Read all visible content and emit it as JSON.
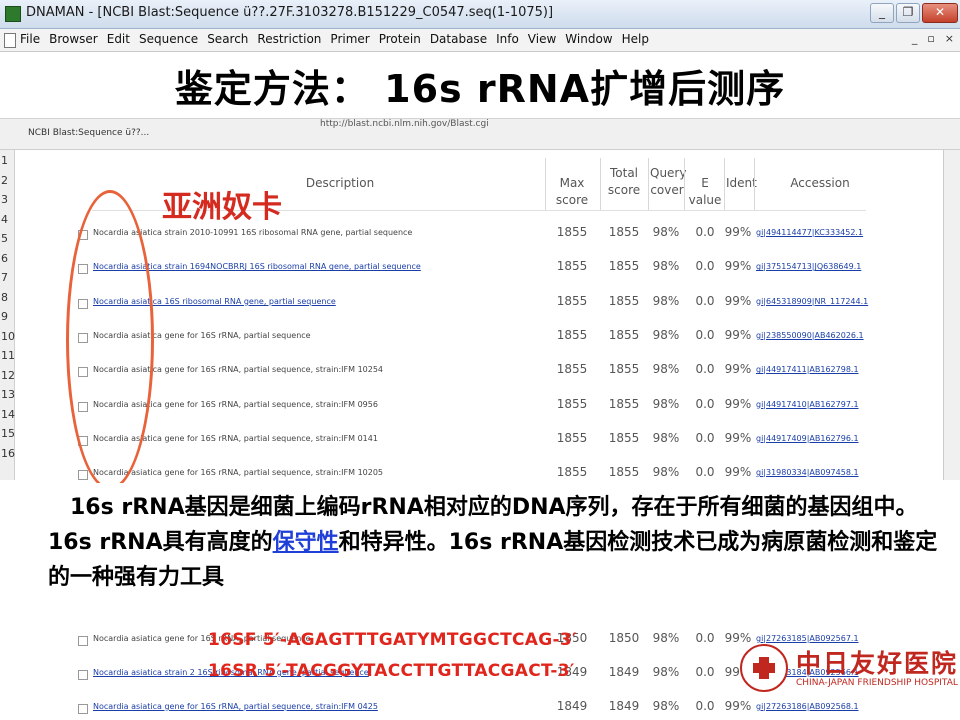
{
  "window": {
    "title": "DNAMAN - [NCBI Blast:Sequence ü??.27F.3103278.B151229_C0547.seq(1-1075)]",
    "controls": {
      "minimize": "_",
      "restore": "❐",
      "close": "✕"
    }
  },
  "menubar": {
    "items": [
      "File",
      "Browser",
      "Edit",
      "Sequence",
      "Search",
      "Restriction",
      "Primer",
      "Protein",
      "Database",
      "Info",
      "View",
      "Window",
      "Help"
    ],
    "mdi": {
      "minimize": "_",
      "restore": "▫",
      "close": "×"
    }
  },
  "slide": {
    "title": "鉴定方法： 16s rRNA扩增后测序",
    "species_label": "亚洲奴卡",
    "paragraph": {
      "part1": "16s rRNA基因是细菌上编码rRNA相对应的DNA序列，存在于所有细菌的基因组中。16s rRNA具有高度的",
      "highlight": "保守性",
      "part2": "和特异性。16s rRNA基因检测技术已成为病原菌检测和鉴定的一种强有力工具"
    },
    "primers": [
      "16SF 5′-AGAGTTTGATYMTGGCTCAG-3′",
      "16SR 5′-TACGGYTACCTTGTTACGACT-3′"
    ]
  },
  "browser": {
    "tab_label": "NCBI Blast:Sequence ü??...",
    "url": "http://blast.ncbi.nlm.nih.gov/Blast.cgi"
  },
  "line_numbers": [
    "1",
    "2",
    "3",
    "4",
    "5",
    "6",
    "7",
    "8",
    "9",
    "10",
    "11",
    "12",
    "13",
    "14",
    "15",
    "16"
  ],
  "table": {
    "headers": {
      "description": "Description",
      "max_score": "Max score",
      "total_score": "Total score",
      "query_cover": "Query cover",
      "e_value": "E value",
      "ident": "Ident",
      "accession": "Accession"
    },
    "rows": [
      {
        "desc": "Nocardia asiatica strain 2010-10991 16S ribosomal RNA gene, partial sequence",
        "link": false,
        "max": "1855",
        "total": "1855",
        "cover": "98%",
        "e": "0.0",
        "ident": "99%",
        "acc": "gi|494114477|KC333452.1"
      },
      {
        "desc": "Nocardia asiatica strain 1694NOCBRRJ 16S ribosomal RNA gene, partial sequence",
        "link": true,
        "max": "1855",
        "total": "1855",
        "cover": "98%",
        "e": "0.0",
        "ident": "99%",
        "acc": "gi|375154713|JQ638649.1"
      },
      {
        "desc": "Nocardia asiatica 16S ribosomal RNA gene, partial sequence",
        "link": true,
        "max": "1855",
        "total": "1855",
        "cover": "98%",
        "e": "0.0",
        "ident": "99%",
        "acc": "gi|645318909|NR_117244.1"
      },
      {
        "desc": "Nocardia asiatica gene for 16S rRNA, partial sequence",
        "link": false,
        "max": "1855",
        "total": "1855",
        "cover": "98%",
        "e": "0.0",
        "ident": "99%",
        "acc": "gi|238550090|AB462026.1"
      },
      {
        "desc": "Nocardia asiatica gene for 16S rRNA, partial sequence, strain:IFM 10254",
        "link": false,
        "max": "1855",
        "total": "1855",
        "cover": "98%",
        "e": "0.0",
        "ident": "99%",
        "acc": "gi|44917411|AB162798.1"
      },
      {
        "desc": "Nocardia asiatica gene for 16S rRNA, partial sequence, strain:IFM 0956",
        "link": false,
        "max": "1855",
        "total": "1855",
        "cover": "98%",
        "e": "0.0",
        "ident": "99%",
        "acc": "gi|44917410|AB162797.1"
      },
      {
        "desc": "Nocardia asiatica gene for 16S rRNA, partial sequence, strain:IFM 0141",
        "link": false,
        "max": "1855",
        "total": "1855",
        "cover": "98%",
        "e": "0.0",
        "ident": "99%",
        "acc": "gi|44917409|AB162796.1"
      },
      {
        "desc": "Nocardia asiatica gene for 16S rRNA, partial sequence, strain:IFM 10205",
        "link": false,
        "max": "1855",
        "total": "1855",
        "cover": "98%",
        "e": "0.0",
        "ident": "99%",
        "acc": "gi|31980334|AB097458.1"
      }
    ],
    "lower_rows": [
      {
        "desc": "Nocardia asiatica gene for 16S rRNA, partial sequence",
        "link": false,
        "max": "1850",
        "total": "1850",
        "cover": "98%",
        "e": "0.0",
        "ident": "99%",
        "acc": "gi|27263185|AB092567.1"
      },
      {
        "desc": "Nocardia asiatica strain 2 16S ribosomal RNA gene, partial sequence",
        "link": true,
        "max": "1849",
        "total": "1849",
        "cover": "98%",
        "e": "0.0",
        "ident": "99%",
        "acc": "gi|27263184|AB092566.1"
      },
      {
        "desc": "Nocardia asiatica gene for 16S rRNA, partial sequence, strain:IFM 0425",
        "link": true,
        "max": "1849",
        "total": "1849",
        "cover": "98%",
        "e": "0.0",
        "ident": "99%",
        "acc": "gi|27263186|AB092568.1"
      }
    ]
  },
  "logo": {
    "name_cn": "中日友好医院",
    "name_en": "CHINA-JAPAN FRIENDSHIP HOSPITAL"
  },
  "colors": {
    "title_text": "#000000",
    "species_label": "#d42a1f",
    "ellipse": "#e8623a",
    "highlight": "#1f3fd8",
    "primer": "#e0261c",
    "link": "#1a3ea8",
    "logo": "#c0271f"
  }
}
